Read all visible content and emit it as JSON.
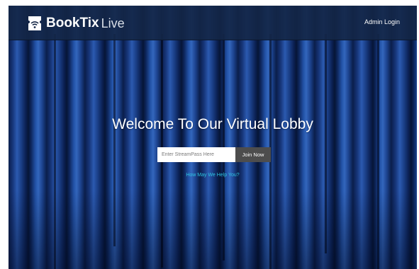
{
  "header": {
    "brand_name": "BookTix",
    "brand_suffix": "Live",
    "admin_login_label": "Admin Login"
  },
  "hero": {
    "welcome_title": "Welcome To Our Virtual Lobby",
    "streampass_placeholder": "Enter StreamPass Here",
    "join_button_label": "Join Now",
    "help_link_label": "How May We Help You?"
  },
  "colors": {
    "header_bg": "#142646",
    "curtain_blue": "#1a3e86",
    "join_button_bg": "#4d4d4d",
    "help_link": "#2ec4e0"
  },
  "icons": {
    "logo": "ticket-stream-icon"
  }
}
